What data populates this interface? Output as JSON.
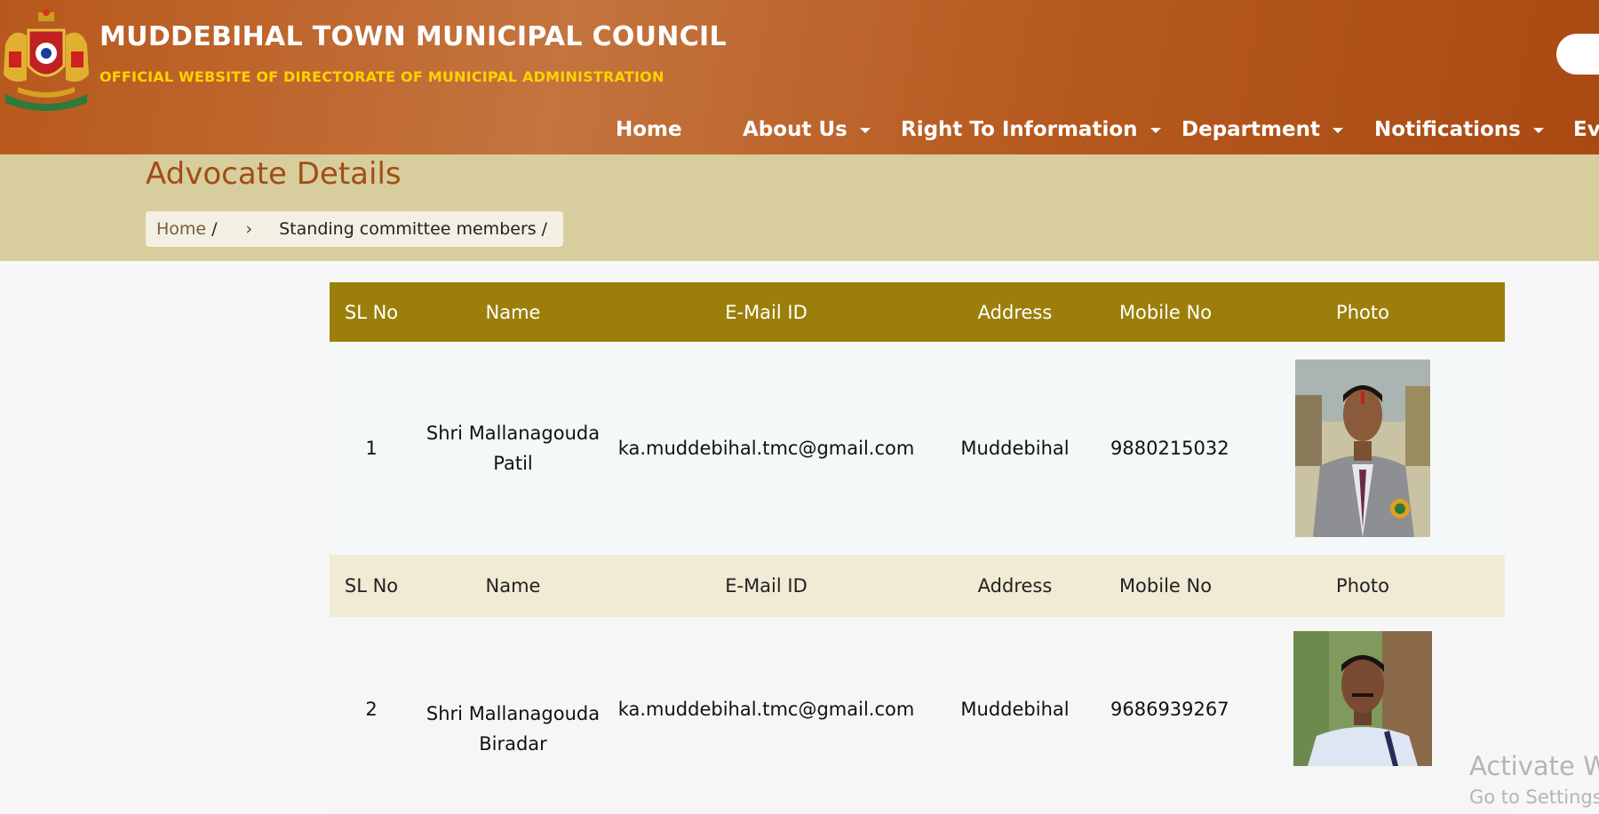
{
  "header": {
    "title": "MUDDEBIHAL TOWN MUNICIPAL COUNCIL",
    "subtitle": "OFFICIAL WEBSITE OF DIRECTORATE OF MUNICIPAL ADMINISTRATION",
    "emblem_icon": "karnataka-emblem-icon"
  },
  "nav": {
    "items": [
      {
        "label": "Home",
        "has_dropdown": false
      },
      {
        "label": "About Us",
        "has_dropdown": true
      },
      {
        "label": "Right To Information",
        "has_dropdown": true
      },
      {
        "label": "Department",
        "has_dropdown": true
      },
      {
        "label": "Notifications",
        "has_dropdown": true
      },
      {
        "label": "Eve",
        "has_dropdown": false
      }
    ]
  },
  "page": {
    "title": "Advocate Details",
    "breadcrumb": {
      "home": "Home",
      "separator": "/",
      "arrow": "›",
      "current": "Standing committee members"
    }
  },
  "table": {
    "columns": [
      "SL No",
      "Name",
      "E-Mail ID",
      "Address",
      "Mobile No",
      "Photo"
    ],
    "rows": [
      {
        "sl": "1",
        "name_line1": "Shri Mallanagouda",
        "name_line2": "Patil",
        "email": "ka.muddebihal.tmc@gmail.com",
        "address": "Muddebihal",
        "mobile": "9880215032"
      },
      {
        "sl": "2",
        "name_line1": "Shri Mallanagouda",
        "name_line2": "Biradar",
        "email": "ka.muddebihal.tmc@gmail.com",
        "address": "Muddebihal",
        "mobile": "9686939267"
      }
    ]
  },
  "watermark": {
    "line1": "Activate W",
    "line2": "Go to Settings"
  },
  "colors": {
    "header_orange": "#b8581c",
    "subtitle_yellow": "#ffd200",
    "band_khaki": "#d8cd9d",
    "table_head": "#9b7f0a",
    "title_brown": "#a14e16"
  }
}
